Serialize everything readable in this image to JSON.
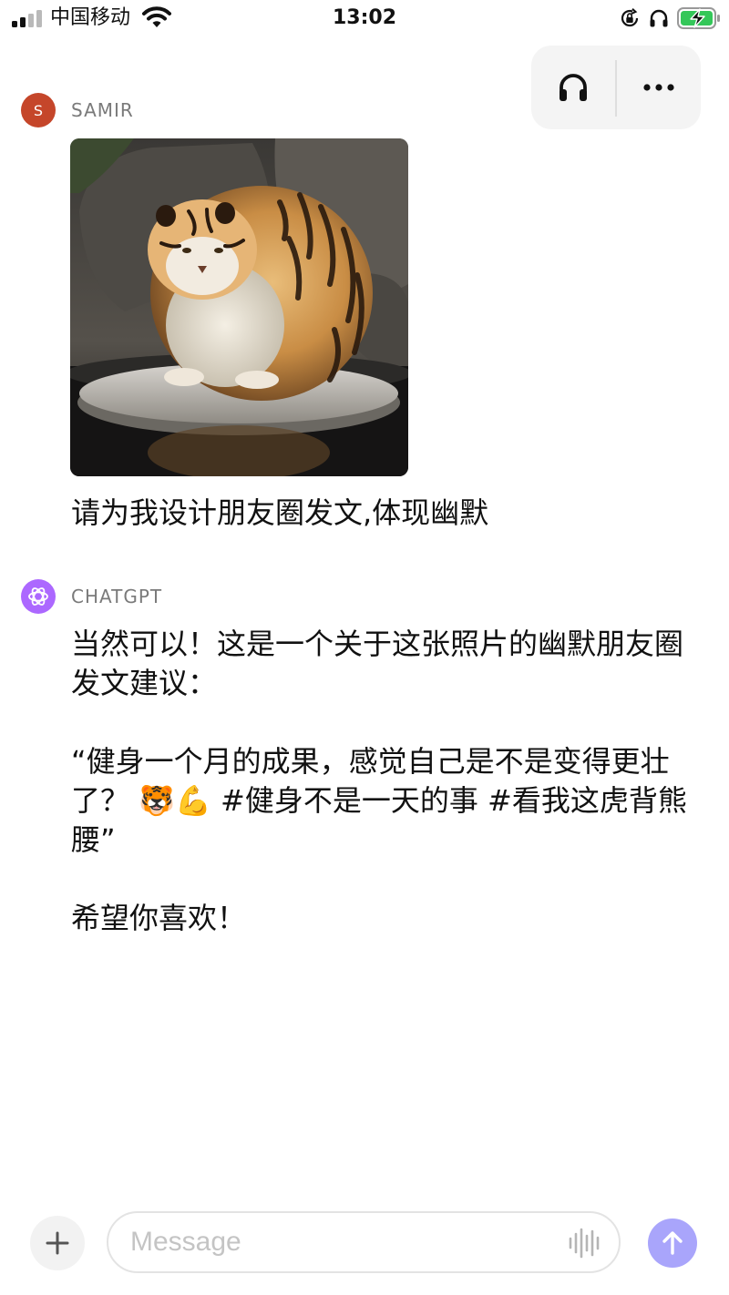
{
  "status_bar": {
    "carrier": "中国移动",
    "time": "13:02",
    "icons": [
      "signal-icon",
      "wifi-icon",
      "orientation-lock-icon",
      "headphones-icon",
      "battery-charging-icon"
    ],
    "battery_color": "#34c759"
  },
  "header": {
    "icons": [
      "headphones-icon",
      "more-icon"
    ]
  },
  "conversation": {
    "user": {
      "avatar_initial": "S",
      "avatar_color": "#c5462a",
      "name": "SAMIR",
      "image_subject": "chubby tiger sitting on a round stone by the water",
      "text": "请为我设计朋友圈发文,体现幽默"
    },
    "assistant": {
      "avatar_color": "#ac68ff",
      "name": "CHATGPT",
      "paragraphs": [
        "当然可以！这是一个关于这张照片的幽默朋友圈发文建议：",
        "“健身一个月的成果，感觉自己是不是变得更壮了？ 🐯💪 #健身不是一天的事 #看我这虎背熊腰”",
        "希望你喜欢！"
      ]
    }
  },
  "composer": {
    "placeholder": "Message",
    "value": "",
    "icons": [
      "plus-icon",
      "waveform-icon",
      "arrow-up-icon"
    ],
    "send_color": "#a9a5fb"
  }
}
